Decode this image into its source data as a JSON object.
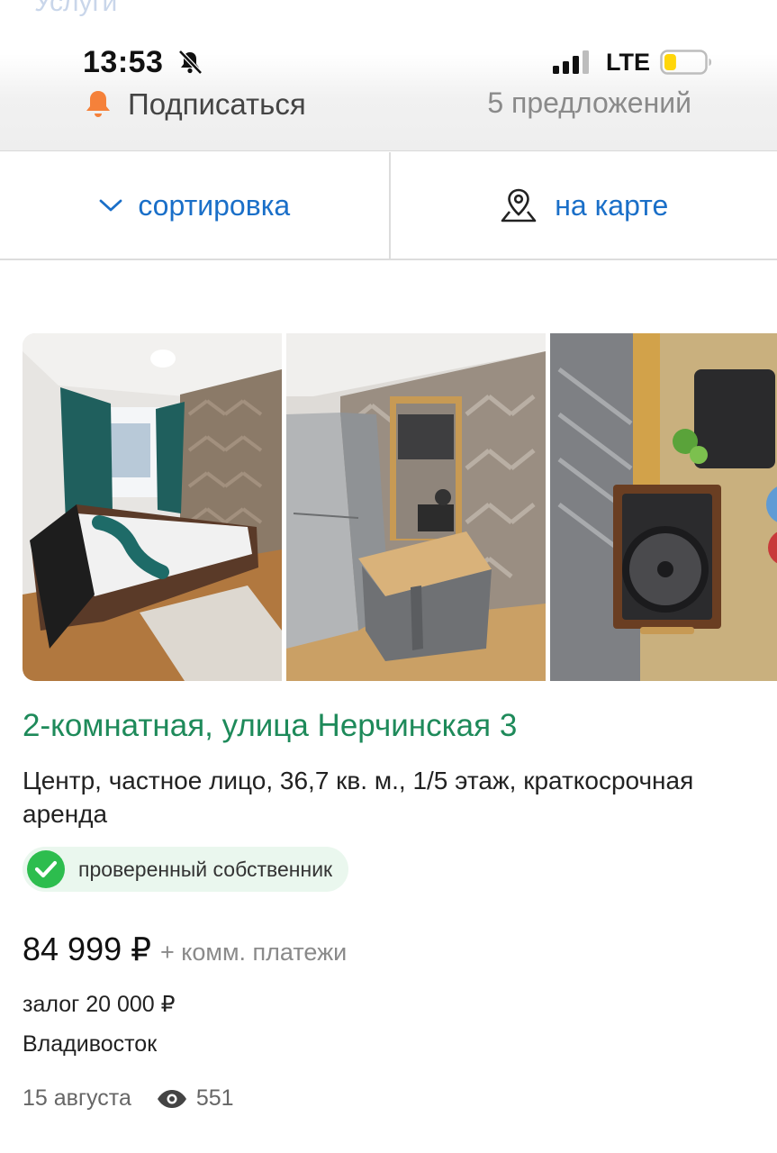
{
  "header": {
    "ghost_text": "Услуги",
    "status": {
      "time": "13:53",
      "network": "LTE",
      "battery_level": 0.3
    },
    "subscribe_label": "Подписаться",
    "offers_count": "5 предложений"
  },
  "toolbar": {
    "sort_label": "сортировка",
    "map_label": "на карте"
  },
  "listing": {
    "photos": [
      {
        "alt": "bedroom"
      },
      {
        "alt": "kitchen"
      },
      {
        "alt": "stove"
      }
    ],
    "title": "2-комнатная, улица Нерчинская 3",
    "description": "Центр, частное лицо, 36,7 кв. м., 1/5 этаж, краткосрочная аренда",
    "badge_label": "проверенный собственник",
    "price": "84 999 ₽",
    "price_extra": "+ комм. платежи",
    "deposit": "залог 20 000 ₽",
    "city": "Владивосток",
    "date": "15 августа",
    "views": "551"
  },
  "colors": {
    "accent_blue": "#1a6fc8",
    "title_green": "#1e8a5a",
    "badge_green": "#2dbd4e",
    "bell_orange": "#f5813a"
  }
}
